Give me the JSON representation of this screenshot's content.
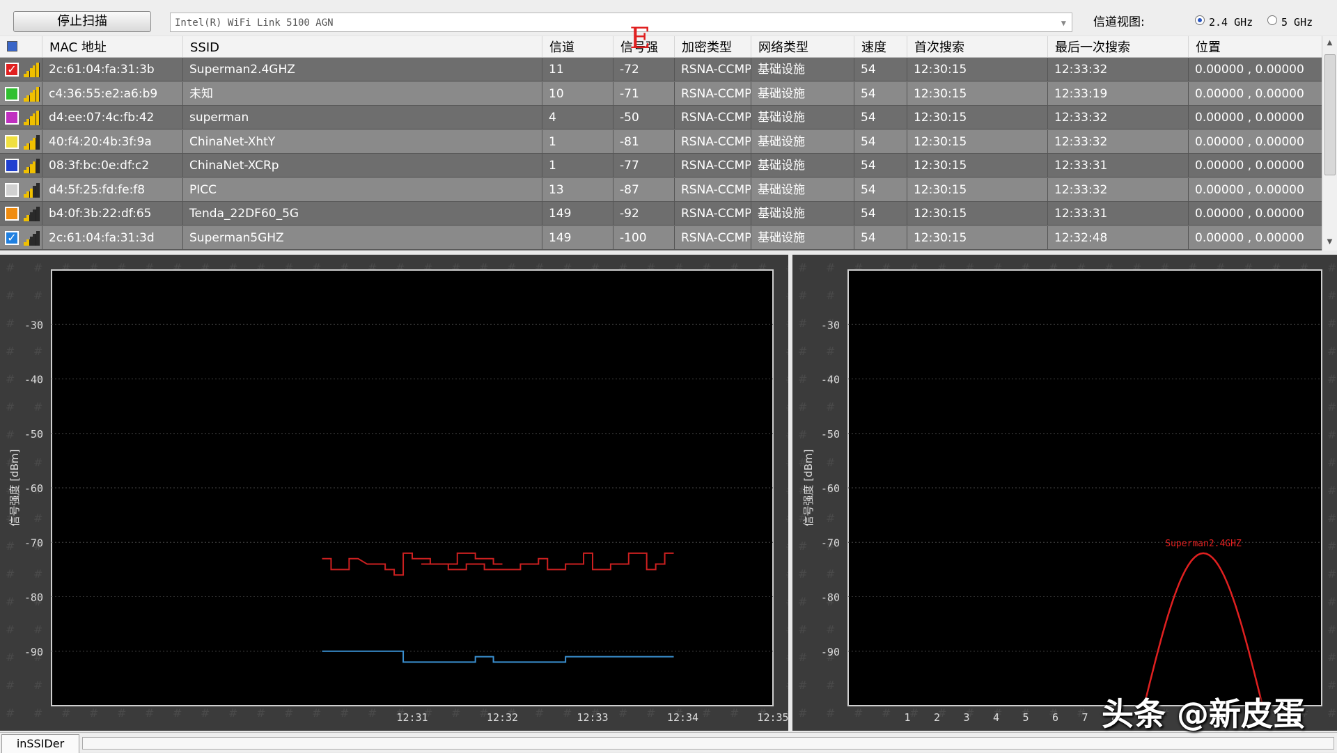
{
  "toolbar": {
    "stop_scan_label": "停止扫描",
    "adapter_value": "Intel(R) WiFi Link 5100 AGN",
    "channel_view_label": "信道视图:",
    "band_24_label": "2.4 GHz",
    "band_5_label": "5 GHz",
    "selected_band": "2.4 GHz"
  },
  "table": {
    "columns": [
      "MAC 地址",
      "SSID",
      "信道",
      "信号强",
      "加密类型",
      "网络类型",
      "速度",
      "首次搜索",
      "最后一次搜索",
      "位置"
    ],
    "rows": [
      {
        "color": "#e02020",
        "checked": true,
        "mac": "2c:61:04:fa:31:3b",
        "ssid": "Superman2.4GHZ",
        "channel": "11",
        "rssi": "-72",
        "security": "RSNA-CCMP",
        "network": "基础设施",
        "speed": "54",
        "first_seen": "12:30:15",
        "last_seen": "12:33:32",
        "location": "0.00000 , 0.00000",
        "signal_level": 0.9
      },
      {
        "color": "#30c030",
        "checked": false,
        "mac": "c4:36:55:e2:a6:b9",
        "ssid": "未知",
        "channel": "10",
        "rssi": "-71",
        "security": "RSNA-CCMP",
        "network": "基础设施",
        "speed": "54",
        "first_seen": "12:30:15",
        "last_seen": "12:33:19",
        "location": "0.00000 , 0.00000",
        "signal_level": 0.9
      },
      {
        "color": "#c030c0",
        "checked": false,
        "mac": "d4:ee:07:4c:fb:42",
        "ssid": "superman",
        "channel": "4",
        "rssi": "-50",
        "security": "RSNA-CCMP",
        "network": "基础设施",
        "speed": "54",
        "first_seen": "12:30:15",
        "last_seen": "12:33:32",
        "location": "0.00000 , 0.00000",
        "signal_level": 1.0
      },
      {
        "color": "#f0e040",
        "checked": false,
        "mac": "40:f4:20:4b:3f:9a",
        "ssid": "ChinaNet-XhtY",
        "channel": "1",
        "rssi": "-81",
        "security": "RSNA-CCMP",
        "network": "基础设施",
        "speed": "54",
        "first_seen": "12:30:15",
        "last_seen": "12:33:32",
        "location": "0.00000 , 0.00000",
        "signal_level": 0.7
      },
      {
        "color": "#2040d0",
        "checked": false,
        "mac": "08:3f:bc:0e:df:c2",
        "ssid": "ChinaNet-XCRp",
        "channel": "1",
        "rssi": "-77",
        "security": "RSNA-CCMP",
        "network": "基础设施",
        "speed": "54",
        "first_seen": "12:30:15",
        "last_seen": "12:33:31",
        "location": "0.00000 , 0.00000",
        "signal_level": 0.7
      },
      {
        "color": "#d0d0d0",
        "checked": false,
        "mac": "d4:5f:25:fd:fe:f8",
        "ssid": "PICC",
        "channel": "13",
        "rssi": "-87",
        "security": "RSNA-CCMP",
        "network": "基础设施",
        "speed": "54",
        "first_seen": "12:30:15",
        "last_seen": "12:33:32",
        "location": "0.00000 , 0.00000",
        "signal_level": 0.5
      },
      {
        "color": "#f08c10",
        "checked": false,
        "mac": "b4:0f:3b:22:df:65",
        "ssid": "Tenda_22DF60_5G",
        "channel": "149",
        "rssi": "-92",
        "security": "RSNA-CCMP",
        "network": "基础设施",
        "speed": "54",
        "first_seen": "12:30:15",
        "last_seen": "12:33:31",
        "location": "0.00000 , 0.00000",
        "signal_level": 0.4
      },
      {
        "color": "#2080e0",
        "checked": true,
        "mac": "2c:61:04:fa:31:3d",
        "ssid": "Superman5GHZ",
        "channel": "149",
        "rssi": "-100",
        "security": "RSNA-CCMP",
        "network": "基础设施",
        "speed": "54",
        "first_seen": "12:30:15",
        "last_seen": "12:32:48",
        "location": "0.00000 , 0.00000",
        "signal_level": 0.3
      }
    ]
  },
  "overlay_marker": "E",
  "chart_data": [
    {
      "type": "line",
      "title": "",
      "xlabel": "",
      "ylabel": "信号强度 [dBm]",
      "xlim": [
        12.27,
        12.35
      ],
      "ylim": [
        -100,
        -20
      ],
      "x_ticks": [
        "12:31",
        "12:32",
        "12:33",
        "12:34",
        "12:35"
      ],
      "x_tick_values": [
        12.31,
        12.32,
        12.33,
        12.34,
        12.35
      ],
      "y_ticks": [
        -30,
        -40,
        -50,
        -60,
        -70,
        -80,
        -90
      ],
      "grid": true,
      "series": [
        {
          "color": "#cc2020",
          "points": [
            [
              12.3,
              -73
            ],
            [
              12.301,
              -73
            ],
            [
              12.301,
              -75
            ],
            [
              12.303,
              -75
            ],
            [
              12.303,
              -73
            ],
            [
              12.304,
              -73
            ],
            [
              12.305,
              -74
            ],
            [
              12.307,
              -74
            ],
            [
              12.307,
              -75
            ],
            [
              12.308,
              -75
            ],
            [
              12.308,
              -76
            ],
            [
              12.309,
              -76
            ],
            [
              12.309,
              -72
            ],
            [
              12.31,
              -72
            ],
            [
              12.31,
              -73
            ],
            [
              12.312,
              -73
            ],
            [
              12.312,
              -74
            ],
            [
              12.314,
              -74
            ],
            [
              12.314,
              -75
            ],
            [
              12.316,
              -75
            ],
            [
              12.316,
              -74
            ],
            [
              12.318,
              -74
            ],
            [
              12.318,
              -75
            ],
            [
              12.322,
              -75
            ],
            [
              12.322,
              -74
            ],
            [
              12.324,
              -74
            ],
            [
              12.324,
              -73
            ],
            [
              12.325,
              -73
            ],
            [
              12.325,
              -75
            ],
            [
              12.327,
              -75
            ],
            [
              12.327,
              -74
            ],
            [
              12.329,
              -74
            ],
            [
              12.329,
              -72
            ],
            [
              12.33,
              -72
            ],
            [
              12.33,
              -75
            ],
            [
              12.332,
              -75
            ],
            [
              12.332,
              -74
            ],
            [
              12.334,
              -74
            ],
            [
              12.334,
              -72
            ],
            [
              12.336,
              -72
            ],
            [
              12.336,
              -75
            ],
            [
              12.337,
              -75
            ],
            [
              12.337,
              -74
            ],
            [
              12.338,
              -74
            ],
            [
              12.338,
              -72
            ],
            [
              12.339,
              -72
            ]
          ]
        },
        {
          "color": "#cc2020",
          "points": [
            [
              12.311,
              -74
            ],
            [
              12.315,
              -74
            ],
            [
              12.315,
              -72
            ],
            [
              12.317,
              -72
            ],
            [
              12.317,
              -73
            ],
            [
              12.319,
              -73
            ],
            [
              12.319,
              -74
            ],
            [
              12.32,
              -74
            ]
          ]
        },
        {
          "color": "#3a8fd0",
          "points": [
            [
              12.3,
              -90
            ],
            [
              12.309,
              -90
            ],
            [
              12.309,
              -92
            ],
            [
              12.317,
              -92
            ],
            [
              12.317,
              -91
            ],
            [
              12.319,
              -91
            ],
            [
              12.319,
              -92
            ],
            [
              12.327,
              -92
            ],
            [
              12.327,
              -91
            ],
            [
              12.339,
              -91
            ]
          ]
        }
      ]
    },
    {
      "type": "area",
      "title": "",
      "xlabel": "",
      "ylabel": "信号强度 [dBm]",
      "xlim": [
        -1,
        15
      ],
      "ylim": [
        -100,
        -20
      ],
      "x_ticks": [
        1,
        2,
        3,
        4,
        5,
        6,
        7,
        8
      ],
      "y_ticks": [
        -30,
        -40,
        -50,
        -60,
        -70,
        -80,
        -90
      ],
      "grid": true,
      "series": [
        {
          "name": "Superman2.4GHZ",
          "color": "#e02020",
          "channel": 11,
          "peak": -72,
          "floor": -100
        }
      ]
    }
  ],
  "statusbar": {
    "tab_label": "inSSIDer"
  },
  "watermark": "头条 @新皮蛋"
}
